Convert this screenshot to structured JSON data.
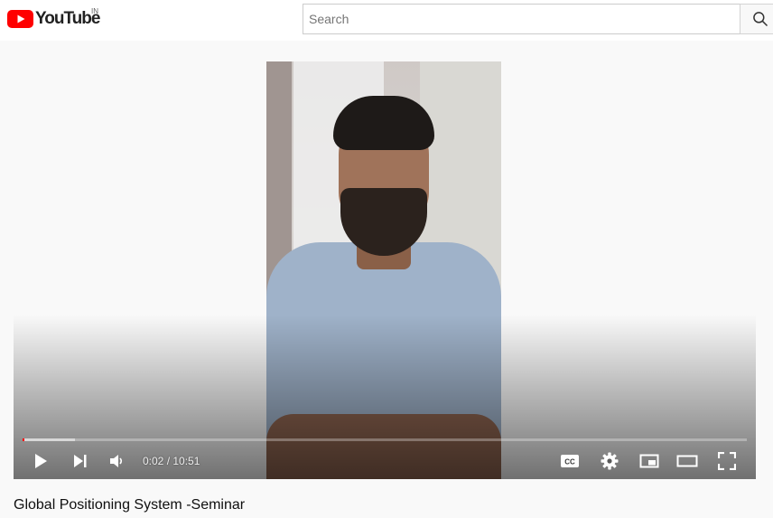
{
  "header": {
    "logo_text": "YouTube",
    "country_code": "IN",
    "search_placeholder": "Search",
    "search_value": "",
    "brand_color": "#ff0000"
  },
  "player": {
    "current_time": "0:02",
    "duration": "10:51",
    "time_display": "0:02 / 10:51",
    "progress_fraction": 0.003,
    "buffered_fraction": 0.072,
    "icons": [
      "play-icon",
      "next-icon",
      "volume-icon",
      "captions-icon",
      "settings-icon",
      "miniplayer-icon",
      "theater-icon",
      "fullscreen-icon"
    ]
  },
  "video": {
    "title": "Global Positioning System -Seminar"
  }
}
